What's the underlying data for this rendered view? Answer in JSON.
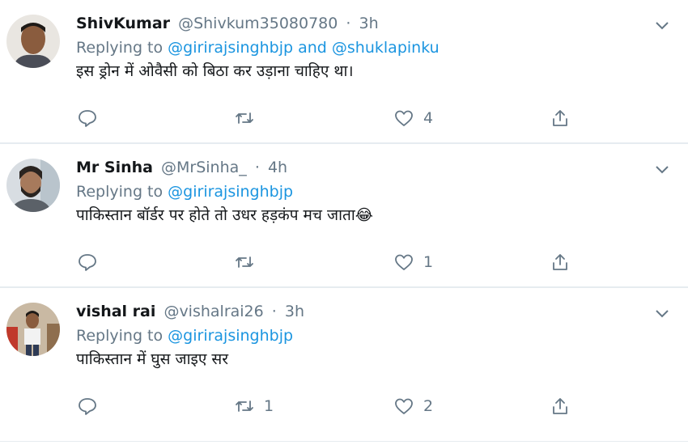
{
  "tweets": [
    {
      "name": "ShivKumar",
      "handle": "@Shivkum35080780",
      "separator": "·",
      "time": "3h",
      "replying_prefix": "Replying to",
      "mention1": "@girirajsinghbjp",
      "joiner": "and",
      "mention2": "@shuklapinku",
      "text": "इस ड्रोन में ओवैसी को बिठा कर उड़ाना चाहिए था।",
      "reply_count": "",
      "retweet_count": "",
      "like_count": "4"
    },
    {
      "name": "Mr Sinha",
      "handle": "@MrSinha_",
      "separator": "·",
      "time": "4h",
      "replying_prefix": "Replying to",
      "mention1": "@girirajsinghbjp",
      "text": "पाकिस्तान बॉर्डर पर होते तो उधर हड़कंप मच जाता😂",
      "reply_count": "",
      "retweet_count": "",
      "like_count": "1"
    },
    {
      "name": "vishal rai",
      "handle": "@vishalrai26",
      "separator": "·",
      "time": "3h",
      "replying_prefix": "Replying to",
      "mention1": "@girirajsinghbjp",
      "text": "पाकिस्तान में घुस जाइए सर",
      "reply_count": "",
      "retweet_count": "1",
      "like_count": "2"
    }
  ],
  "icons": {
    "reply": "reply-icon",
    "retweet": "retweet-icon",
    "like": "heart-icon",
    "share": "share-icon",
    "menu": "chevron-down-icon"
  },
  "colors": {
    "link": "#1b95e0",
    "secondary_text": "#657786",
    "divider": "#e6ecf0"
  }
}
